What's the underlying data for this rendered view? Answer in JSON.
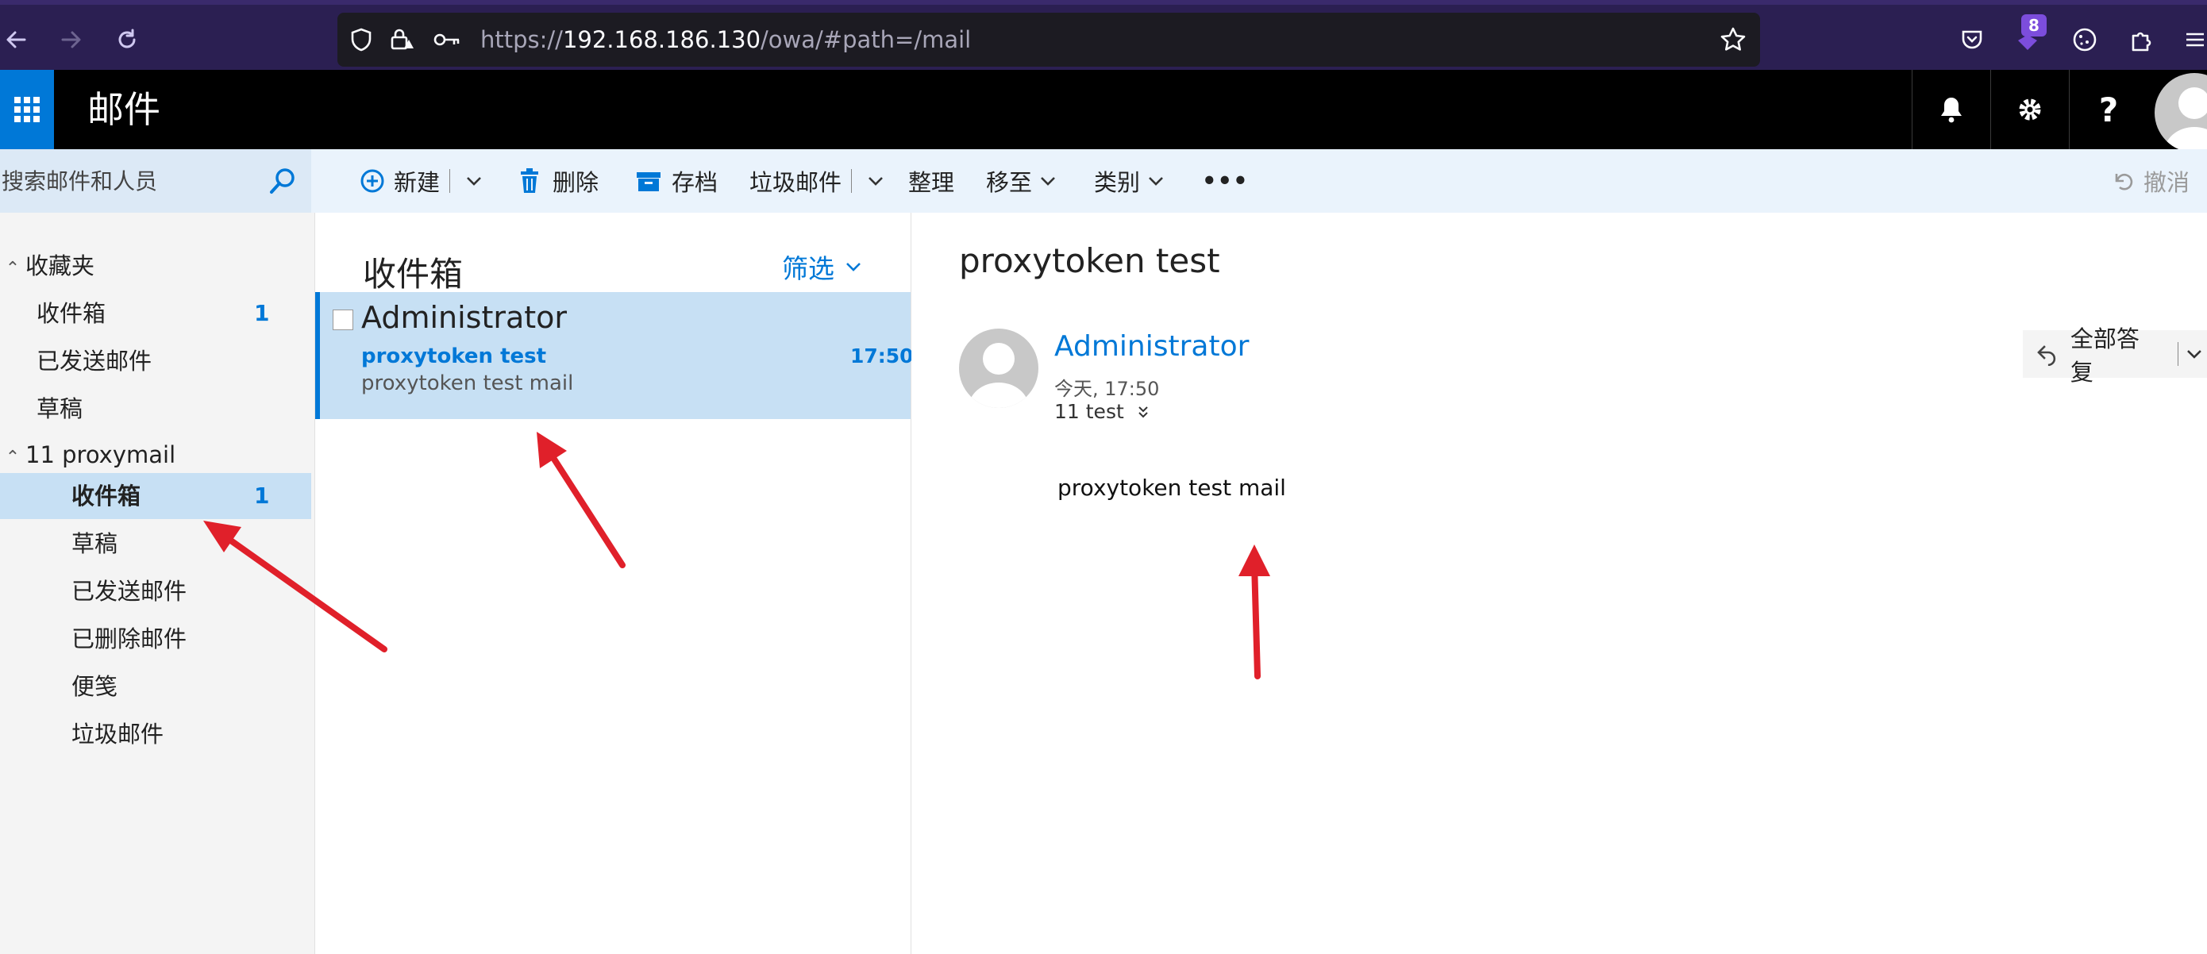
{
  "browser": {
    "url_prefix": "https://",
    "url_host": "192.168.186.130",
    "url_path": "/owa/#path=/mail",
    "extension_badge": "8",
    "accent": "#2b1f52"
  },
  "app": {
    "title": "邮件",
    "accent": "#0078d7"
  },
  "search": {
    "placeholder": "搜索邮件和人员"
  },
  "toolbar": {
    "new_label": "新建",
    "delete_label": "删除",
    "archive_label": "存档",
    "junk_label": "垃圾邮件",
    "sweep_label": "整理",
    "move_label": "移至",
    "category_label": "类别",
    "more_label": "•••",
    "undo_label": "撤消"
  },
  "folders": {
    "favorites_label": "收藏夹",
    "favorites": [
      {
        "label": "收件箱",
        "count": "1"
      },
      {
        "label": "已发送邮件"
      },
      {
        "label": "草稿"
      }
    ],
    "mailbox_label": "11 proxymail",
    "mailbox": [
      {
        "label": "收件箱",
        "count": "1",
        "selected": true
      },
      {
        "label": "草稿"
      },
      {
        "label": "已发送邮件"
      },
      {
        "label": "已删除邮件"
      },
      {
        "label": "便笺"
      },
      {
        "label": "垃圾邮件"
      }
    ]
  },
  "message_list": {
    "title": "收件箱",
    "filter_label": "筛选",
    "messages": [
      {
        "sender": "Administrator",
        "subject": "proxytoken test",
        "time": "17:50",
        "preview": "proxytoken test mail"
      }
    ]
  },
  "reading": {
    "subject": "proxytoken test",
    "sender": "Administrator",
    "date": "今天, 17:50",
    "to": "11 test",
    "reply_all_label": "全部答复",
    "body": "proxytoken test mail"
  },
  "annotations": {
    "arrow_color": "#e0202a"
  }
}
